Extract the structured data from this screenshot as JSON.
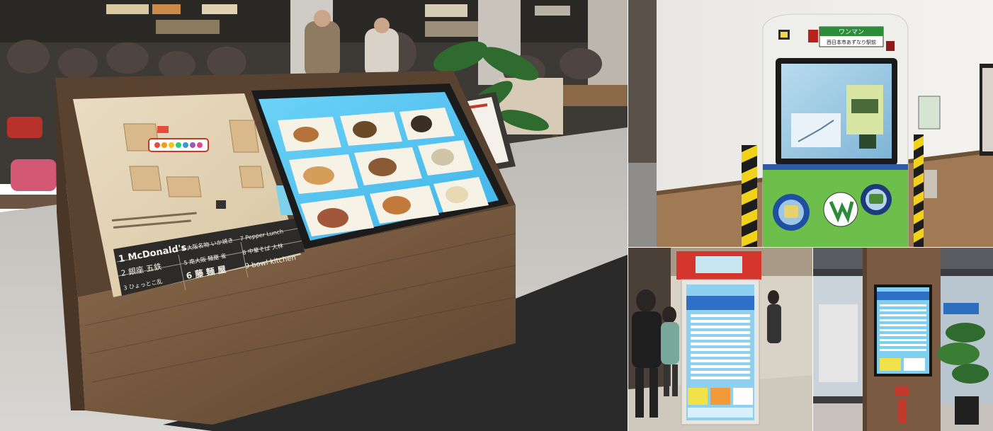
{
  "food_court": {
    "restaurants": [
      {
        "num": "1",
        "name": "McDonald's"
      },
      {
        "num": "2",
        "name": "銀座 五鉄"
      },
      {
        "num": "3",
        "name": "ひょっとこ乱"
      },
      {
        "num": "4",
        "name": "大阪名物 いか焼き"
      },
      {
        "num": "5",
        "name": "南大阪 麺屋 雀"
      },
      {
        "num": "6",
        "name": "藤 麺 屋"
      },
      {
        "num": "7",
        "name": "Pepper Lunch"
      },
      {
        "num": "8",
        "name": "中華そば 大林"
      },
      {
        "num": "9",
        "name": "bowl kitchen"
      }
    ]
  },
  "train_kiosk": {
    "route_label": "ワンマン",
    "destination": "西日本市あずなり駅前"
  },
  "colors": {
    "wood": "#7a5b3e",
    "screen_blue": "#5cc8f2",
    "train_green": "#6cbf4a",
    "floor_gray": "#c9c7c4"
  }
}
